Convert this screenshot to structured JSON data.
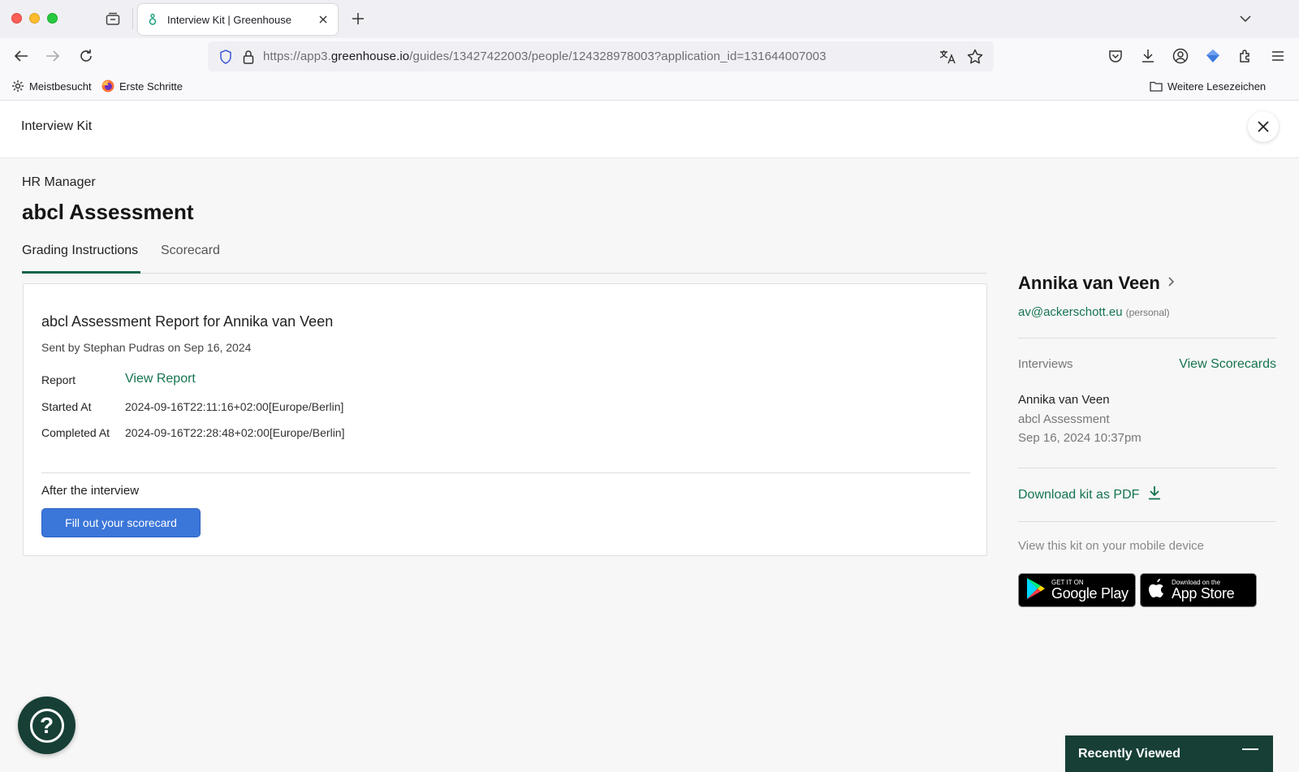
{
  "browser": {
    "tab_title": "Interview Kit | Greenhouse",
    "url_prefix": "https://app3.",
    "url_domain": "greenhouse.io",
    "url_path": "/guides/13427422003/people/124328978003?application_id=131644007003",
    "bookmarks": [
      "Meistbesucht",
      "Erste Schritte"
    ],
    "bookmarks_right": "Weitere Lesezeichen"
  },
  "header": {
    "title": "Interview Kit"
  },
  "kit": {
    "role": "HR Manager",
    "title": "abcl Assessment",
    "tabs": [
      "Grading Instructions",
      "Scorecard"
    ],
    "active_tab": "Grading Instructions"
  },
  "report": {
    "title": "abcl Assessment Report for Annika van Veen",
    "sent_by": "Sent by Stephan Pudras on Sep 16, 2024",
    "rows": [
      {
        "label": "Report",
        "value": "View Report"
      },
      {
        "label": "Started At",
        "value": "2024-09-16T22:11:16+02:00[Europe/Berlin]"
      },
      {
        "label": "Completed At",
        "value": "2024-09-16T22:28:48+02:00[Europe/Berlin]"
      }
    ],
    "after_label": "After the interview",
    "fill_button": "Fill out your scorecard"
  },
  "candidate": {
    "name": "Annika van Veen",
    "email": "av@ackerschott.eu",
    "email_tag": "(personal)",
    "interviews_label": "Interviews",
    "view_scorecards": "View Scorecards",
    "interview": {
      "name": "Annika van Veen",
      "type": "abcl Assessment",
      "date": "Sep 16, 2024 10:37pm"
    },
    "download_label": "Download kit as PDF",
    "mobile_label": "View this kit on your mobile device",
    "google_play": {
      "small": "GET IT ON",
      "big": "Google Play"
    },
    "app_store": {
      "small": "Download on the",
      "big": "App Store"
    }
  },
  "widgets": {
    "help_symbol": "?",
    "recently_viewed": "Recently Viewed"
  },
  "colors": {
    "brand_green": "#15744f",
    "dark_green": "#173f36",
    "button_blue": "#3b76d9"
  }
}
